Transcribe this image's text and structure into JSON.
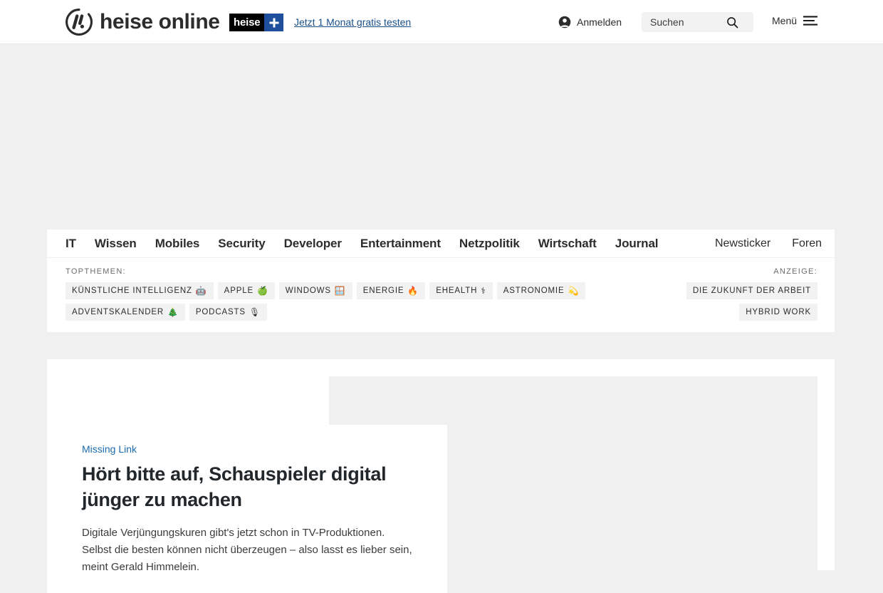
{
  "header": {
    "logo_text": "heise online",
    "logo_icon": "heise-circle-logo",
    "plus_badge": {
      "word": "heise",
      "symbol": "+"
    },
    "promo_link": "Jetzt 1 Monat gratis testen",
    "account_label": "Anmelden",
    "account_icon": "user-circle-icon",
    "search": {
      "placeholder": "Suchen",
      "value": "",
      "icon": "search-icon"
    },
    "menu_label": "Menü",
    "menu_icon": "hamburger-icon"
  },
  "nav": {
    "primary": [
      "IT",
      "Wissen",
      "Mobiles",
      "Security",
      "Developer",
      "Entertainment",
      "Netzpolitik",
      "Wirtschaft",
      "Journal"
    ],
    "secondary": [
      "Newsticker",
      "Foren"
    ]
  },
  "topics": {
    "label": "TOPTHEMEN:",
    "chips": [
      {
        "label": "KÜNSTLICHE INTELLIGENZ",
        "emoji": "🤖"
      },
      {
        "label": "APPLE",
        "emoji": "🍏"
      },
      {
        "label": "WINDOWS",
        "emoji": "🪟"
      },
      {
        "label": "ENERGIE",
        "emoji": "🔥"
      },
      {
        "label": "EHEALTH",
        "emoji": "⚕"
      },
      {
        "label": "ASTRONOMIE",
        "emoji": "💫"
      },
      {
        "label": "ADVENTSKALENDER",
        "emoji": "🎄"
      },
      {
        "label": "PODCASTS",
        "emoji": "🎙"
      }
    ]
  },
  "ads": {
    "label": "ANZEIGE:",
    "chips": [
      {
        "label": "DIE ZUKUNFT DER ARBEIT"
      },
      {
        "label": "HYBRID WORK"
      }
    ]
  },
  "lead_article": {
    "kicker": "Missing Link",
    "title": "Hört bitte auf, Schauspieler digital jünger zu machen",
    "teaser": "Digitale Verjüngungskuren gibt's jetzt schon in TV-Produktionen. Selbst die besten können nicht überzeugen – also lasst es lieber sein, meint Gerald Himmelein."
  },
  "colors": {
    "page_bg": "#f0f0f0",
    "panel_bg": "#ffffff",
    "link_blue": "#1a6bb0",
    "promo_blue": "#1a4f8a",
    "plus_blue": "#1e4f9c",
    "text": "#2c2c2c",
    "chip_bg": "#f2f2f2"
  }
}
